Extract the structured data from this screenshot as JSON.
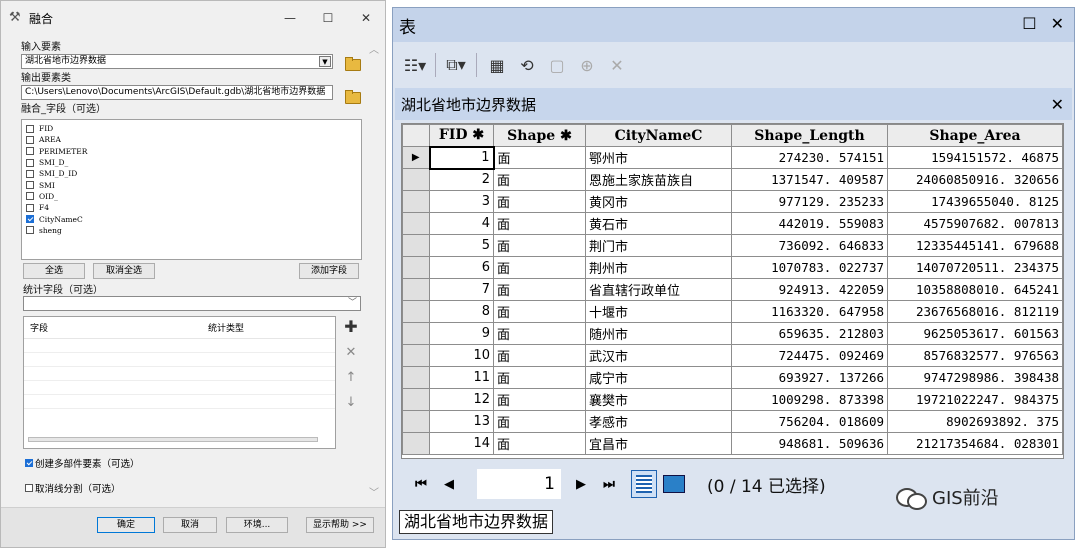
{
  "dialog": {
    "title": "融合",
    "win": {
      "minimize": "—",
      "maximize": "☐",
      "close": "✕"
    },
    "input_label": "输入要素",
    "input_value": "湖北省地市边界数据",
    "output_label": "输出要素类",
    "output_value": "C:\\Users\\Lenovo\\Documents\\ArcGIS\\Default.gdb\\湖北省地市边界数据",
    "dissolve_label": "融合_字段（可选）",
    "fields": [
      {
        "name": "FID",
        "checked": false
      },
      {
        "name": "AREA",
        "checked": false
      },
      {
        "name": "PERIMETER",
        "checked": false
      },
      {
        "name": "SMI_D_",
        "checked": false
      },
      {
        "name": "SMI_D_ID",
        "checked": false
      },
      {
        "name": "SMI",
        "checked": false
      },
      {
        "name": "OID_",
        "checked": false
      },
      {
        "name": "F4",
        "checked": false
      },
      {
        "name": "CityNameC",
        "checked": true
      },
      {
        "name": "sheng",
        "checked": false
      }
    ],
    "select_all": "全选",
    "unselect_all": "取消全选",
    "add_field": "添加字段",
    "stats_label": "统计字段（可选）",
    "stats_col_field": "字段",
    "stats_col_type": "统计类型",
    "multipart_label": "创建多部件要素（可选）",
    "multipart_checked": true,
    "unsplit_label": "取消线分割（可选）",
    "unsplit_checked": false,
    "ok": "确定",
    "cancel": "取消",
    "env": "环境...",
    "help": "显示帮助 >>"
  },
  "table_window": {
    "title": "表",
    "layer_name": "湖北省地市边界数据",
    "columns": [
      "FID",
      "Shape",
      "CityNameC",
      "Shape_Length",
      "Shape_Area"
    ],
    "rows": [
      [
        "1",
        "面",
        "鄂州市",
        "274230. 574151",
        "1594151572. 46875"
      ],
      [
        "2",
        "面",
        "恩施土家族苗族自",
        "1371547. 409587",
        "24060850916. 320656"
      ],
      [
        "3",
        "面",
        "黄冈市",
        "977129. 235233",
        "17439655040. 8125"
      ],
      [
        "4",
        "面",
        "黄石市",
        "442019. 559083",
        "4575907682. 007813"
      ],
      [
        "5",
        "面",
        "荆门市",
        "736092. 646833",
        "12335445141. 679688"
      ],
      [
        "6",
        "面",
        "荆州市",
        "1070783. 022737",
        "14070720511. 234375"
      ],
      [
        "7",
        "面",
        "省直辖行政单位",
        "924913. 422059",
        "10358808010. 645241"
      ],
      [
        "8",
        "面",
        "十堰市",
        "1163320. 647958",
        "23676568016. 812119"
      ],
      [
        "9",
        "面",
        "随州市",
        "659635. 212803",
        "9625053617. 601563"
      ],
      [
        "10",
        "面",
        "武汉市",
        "724475. 092469",
        "8576832577. 976563"
      ],
      [
        "11",
        "面",
        "咸宁市",
        "693927. 137266",
        "9747298986. 398438"
      ],
      [
        "12",
        "面",
        "襄樊市",
        "1009298. 873398",
        "19721022247. 984375"
      ],
      [
        "13",
        "面",
        "孝感市",
        "756204. 018609",
        "8902693892. 375"
      ],
      [
        "14",
        "面",
        "宜昌市",
        "948681. 509636",
        "21217354684. 028301"
      ]
    ],
    "current_record": "1",
    "selection_status": "(0 / 14 已选择)",
    "tab_label": "湖北省地市边界数据"
  },
  "watermark": "GIS前沿"
}
